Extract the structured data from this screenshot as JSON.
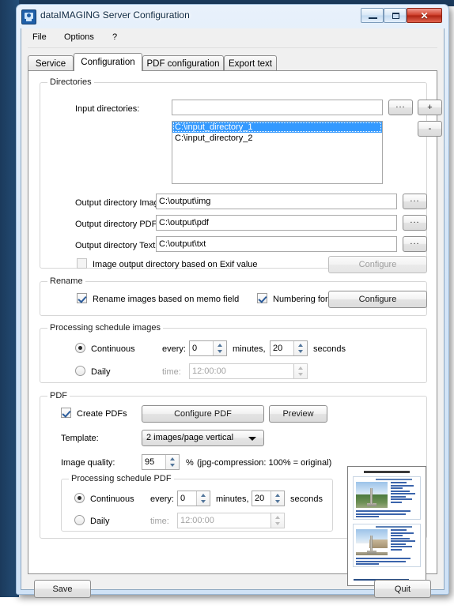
{
  "window": {
    "title": "dataIMAGING Server Configuration",
    "app_icon": "camera-monitor-icon",
    "minimize_label": "–",
    "maximize_label": "□",
    "close_label": "✕"
  },
  "menu": {
    "items": [
      {
        "label": "File"
      },
      {
        "label": "Options"
      },
      {
        "label": "?"
      }
    ]
  },
  "tabs": [
    {
      "label": "Service",
      "active": false
    },
    {
      "label": "Configuration",
      "active": true
    },
    {
      "label": "PDF configuration",
      "active": false
    },
    {
      "label": "Export text",
      "active": false
    }
  ],
  "directories": {
    "group_label": "Directories",
    "input_label": "Input directories:",
    "input_value": "",
    "input_placeholder": "",
    "browse_label": "...",
    "add_label": "+",
    "remove_label": "-",
    "list": [
      {
        "path": "C:\\input_directory_1",
        "selected": true
      },
      {
        "path": "C:\\input_directory_2",
        "selected": false
      }
    ],
    "output_images_label": "Output directory Images:",
    "output_images_value": "C:\\output\\img",
    "output_pdf_label": "Output directory PDF:",
    "output_pdf_value": "C:\\output\\pdf",
    "output_text_label": "Output directory Text:",
    "output_text_value": "C:\\output\\txt",
    "exif_checkbox_label": "Image output directory based on Exif value",
    "exif_checked": false,
    "exif_configure_label": "Configure",
    "exif_configure_enabled": false
  },
  "rename": {
    "group_label": "Rename",
    "memo_label": "Rename images based on memo field",
    "memo_checked": true,
    "numbering_label": "Numbering for all",
    "numbering_checked": true,
    "configure_label": "Configure"
  },
  "schedule_images": {
    "group_label": "Processing schedule images",
    "continuous_label": "Continuous",
    "continuous_selected": true,
    "every_label": "every:",
    "minutes_value": "0",
    "minutes_label": "minutes,",
    "seconds_value": "20",
    "seconds_label": "seconds",
    "daily_label": "Daily",
    "daily_selected": false,
    "time_label": "time:",
    "time_value": "12:00:00"
  },
  "pdf": {
    "group_label": "PDF",
    "create_label": "Create PDFs",
    "create_checked": true,
    "configure_label": "Configure PDF",
    "preview_label": "Preview",
    "template_label": "Template:",
    "template_value": "2 images/page vertical",
    "template_options": [
      "2 images/page vertical"
    ],
    "quality_label": "Image quality:",
    "quality_value": "95",
    "quality_unit": "%",
    "quality_hint": "(jpg-compression: 100% = original)",
    "thumbnail_name": "pdf-preview-thumbnail"
  },
  "schedule_pdf": {
    "group_label": "Processing schedule PDF",
    "continuous_label": "Continuous",
    "continuous_selected": true,
    "every_label": "every:",
    "minutes_value": "0",
    "minutes_label": "minutes,",
    "seconds_value": "20",
    "seconds_label": "seconds",
    "daily_label": "Daily",
    "daily_selected": false,
    "time_label": "time:",
    "time_value": "12:00:00"
  },
  "footer": {
    "save_label": "Save",
    "quit_label": "Quit"
  },
  "colors": {
    "selection_blue": "#3399ff",
    "title_glass": "#d4e5f7",
    "close_red": "#cf3f2b",
    "panel_bg": "#f0f0f0"
  }
}
